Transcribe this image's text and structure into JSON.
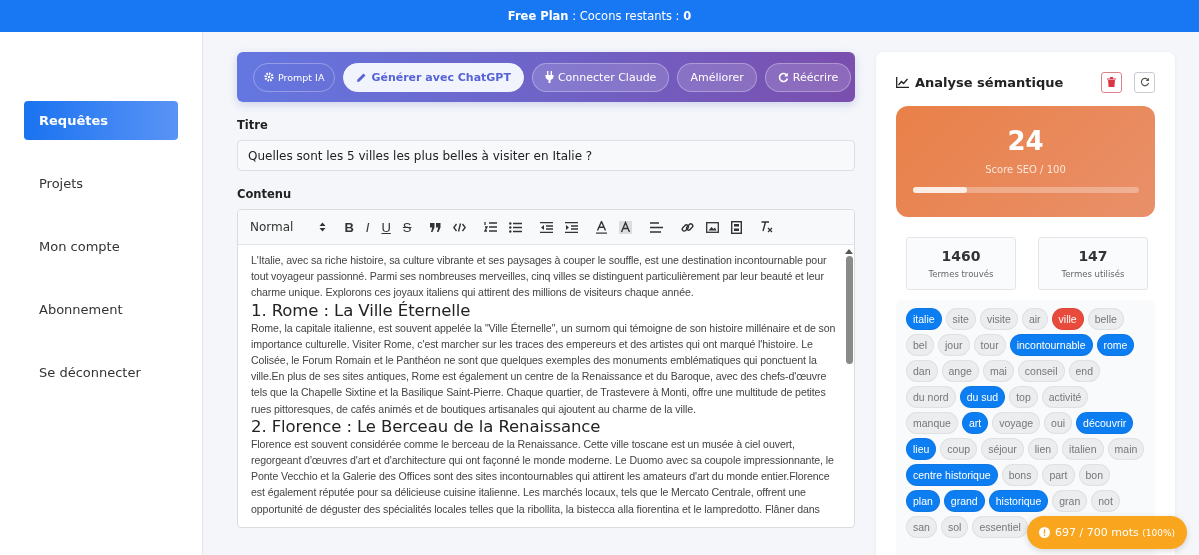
{
  "banner": {
    "plan": "Free Plan",
    "text": " : Cocons restants : ",
    "count": "0"
  },
  "sidebar": {
    "items": [
      {
        "label": "Requêtes",
        "selected": true
      },
      {
        "label": "Projets",
        "selected": false
      },
      {
        "label": "Mon compte",
        "selected": false
      },
      {
        "label": "Abonnement",
        "selected": false
      },
      {
        "label": "Se déconnecter",
        "selected": false
      }
    ]
  },
  "ai_toolbar": {
    "buttons": [
      {
        "label": "Prompt IA",
        "kind": "gear",
        "selected": false
      },
      {
        "label": "Générer avec ChatGPT",
        "kind": "pencil",
        "selected": true
      },
      {
        "label": "Connecter Claude",
        "kind": "plug",
        "selected": false
      },
      {
        "label": "Améliorer",
        "kind": "none",
        "selected": false
      },
      {
        "label": "Réécrire",
        "kind": "refresh",
        "selected": false
      }
    ]
  },
  "title_field": {
    "label": "Titre",
    "value": "Quelles sont les 5 villes les plus belles à visiter en Italie ?"
  },
  "editor": {
    "label": "Contenu",
    "format": "Normal",
    "format_buttons": [
      "B",
      "I",
      "U",
      "S"
    ],
    "blocks": [
      {
        "kind": "p",
        "text": "L'Italie, avec sa riche histoire, sa culture vibrante et ses paysages à couper le souffle, est une destination incontournable pour tout voyageur passionné. Parmi ses nombreuses merveilles, cinq villes se distinguent particulièrement par leur beauté et leur charme unique. Explorons ces joyaux italiens qui attirent des millions de visiteurs chaque année."
      },
      {
        "kind": "h2",
        "text": "1. Rome : La Ville Éternelle"
      },
      {
        "kind": "p",
        "text": "Rome, la capitale italienne, est souvent appelée la \"Ville Éternelle\", un surnom qui témoigne de son histoire millénaire et de son importance culturelle. Visiter Rome, c'est marcher sur les traces des empereurs et des artistes qui ont marqué l'histoire. Le Colisée, le Forum Romain et le Panthéon ne sont que quelques exemples des monuments emblématiques qui ponctuent la ville.En plus de ses sites antiques, Rome est également un centre de la Renaissance et du Baroque, avec des chefs-d'œuvre tels que la Chapelle Sixtine et la Basilique Saint-Pierre. Chaque quartier, de Trastevere à Monti, offre une multitude de petites rues pittoresques, de cafés animés et de boutiques artisanales qui ajoutent au charme de la ville."
      },
      {
        "kind": "h2",
        "text": "2. Florence : Le Berceau de la Renaissance"
      },
      {
        "kind": "p",
        "text": "Florence est souvent considérée comme le berceau de la Renaissance. Cette ville toscane est un musée à ciel ouvert, regorgeant d'œuvres d'art et d'architecture qui ont façonné le monde moderne. Le Duomo avec sa coupole impressionnante, le Ponte Vecchio et la Galerie des Offices sont des sites incontournables qui attirent les amateurs d'art du monde entier.Florence est également réputée pour sa délicieuse cuisine italienne. Les marchés locaux, tels que le Mercato Centrale, offrent une opportunité de déguster des spécialités locales telles que la ribollita, la bistecca alla fiorentina et le lampredotto. Flâner dans"
      }
    ]
  },
  "analysis": {
    "title": "Analyse sémantique",
    "score": "24",
    "score_label": "Score SEO / 100",
    "level": 0.24,
    "stats": [
      {
        "value": "1460",
        "label": "Termes trouvés"
      },
      {
        "value": "147",
        "label": "Termes utilisés"
      }
    ],
    "term_rows": [
      {
        "terms": [
          {
            "text": "italie",
            "color": "#0d7ef2"
          },
          {
            "text": "site",
            "color": "#ebedef"
          },
          {
            "text": "visite",
            "color": "#ebedef"
          },
          {
            "text": "air",
            "color": "#ebedef"
          },
          {
            "text": "ville",
            "color": "#e84a3c"
          },
          {
            "text": "belle",
            "color": "#ebedef"
          }
        ]
      },
      {
        "terms": [
          {
            "text": "bel",
            "color": "#ebedef"
          },
          {
            "text": "jour",
            "color": "#ebedef"
          },
          {
            "text": "tour",
            "color": "#ebedef"
          },
          {
            "text": "incontournable",
            "color": "#0d7ef2"
          },
          {
            "text": "rome",
            "color": "#0d7ef2"
          }
        ]
      },
      {
        "terms": [
          {
            "text": "dan",
            "color": "#ebedef"
          },
          {
            "text": "ange",
            "color": "#ebedef"
          },
          {
            "text": "mai",
            "color": "#ebedef"
          },
          {
            "text": "conseil",
            "color": "#ebedef"
          },
          {
            "text": "end",
            "color": "#ebedef"
          }
        ]
      },
      {
        "terms": [
          {
            "text": "du nord",
            "color": "#ebedef"
          },
          {
            "text": "du sud",
            "color": "#0d7ef2"
          },
          {
            "text": "top",
            "color": "#ebedef"
          },
          {
            "text": "activité",
            "color": "#ebedef"
          }
        ]
      },
      {
        "terms": [
          {
            "text": "manque",
            "color": "#ebedef"
          },
          {
            "text": "art",
            "color": "#0d7ef2"
          },
          {
            "text": "voyage",
            "color": "#ebedef"
          },
          {
            "text": "oui",
            "color": "#ebedef"
          },
          {
            "text": "découvrir",
            "color": "#0d7ef2"
          }
        ]
      },
      {
        "terms": [
          {
            "text": "lieu",
            "color": "#0d7ef2"
          },
          {
            "text": "coup",
            "color": "#ebedef"
          },
          {
            "text": "séjour",
            "color": "#ebedef"
          },
          {
            "text": "lien",
            "color": "#ebedef"
          },
          {
            "text": "italien",
            "color": "#ebedef"
          },
          {
            "text": "main",
            "color": "#ebedef"
          }
        ]
      },
      {
        "terms": [
          {
            "text": "centre historique",
            "color": "#0d7ef2"
          },
          {
            "text": "bons",
            "color": "#ebedef"
          },
          {
            "text": "part",
            "color": "#ebedef"
          },
          {
            "text": "bon",
            "color": "#ebedef"
          }
        ]
      },
      {
        "terms": [
          {
            "text": "plan",
            "color": "#0d7ef2"
          },
          {
            "text": "grand",
            "color": "#0d7ef2"
          },
          {
            "text": "historique",
            "color": "#0d7ef2"
          },
          {
            "text": "gran",
            "color": "#ebedef"
          },
          {
            "text": "not",
            "color": "#ebedef"
          }
        ]
      },
      {
        "terms": [
          {
            "text": "san",
            "color": "#ebedef"
          },
          {
            "text": "sol",
            "color": "#ebedef"
          },
          {
            "text": "essentiel",
            "color": "#ebedef"
          }
        ]
      }
    ]
  },
  "word_count": {
    "text": "697 / 700 mots",
    "percent": "(100%)"
  }
}
